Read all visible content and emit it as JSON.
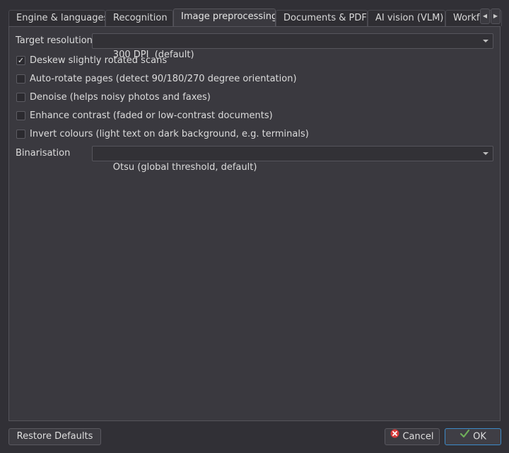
{
  "tabs": [
    {
      "label": "Engine & languages",
      "active": false
    },
    {
      "label": "Recognition",
      "active": false
    },
    {
      "label": "Image preprocessing",
      "active": true
    },
    {
      "label": "Documents & PDF",
      "active": false
    },
    {
      "label": "AI vision (VLM)",
      "active": false
    },
    {
      "label": "Workf",
      "active": false
    }
  ],
  "settings": {
    "target_resolution": {
      "label": "Target resolution",
      "value": "300 DPI  (default)"
    },
    "checkboxes": [
      {
        "label": "Deskew slightly rotated scans",
        "checked": true
      },
      {
        "label": "Auto-rotate pages (detect 90/180/270 degree orientation)",
        "checked": false
      },
      {
        "label": "Denoise (helps noisy photos and faxes)",
        "checked": false
      },
      {
        "label": "Enhance contrast (faded or low-contrast documents)",
        "checked": false
      },
      {
        "label": "Invert colours (light text on dark background, e.g. terminals)",
        "checked": false
      }
    ],
    "binarisation": {
      "label": "Binarisation",
      "value": "Otsu (global threshold, default)"
    }
  },
  "buttons": {
    "restore_defaults": "Restore Defaults",
    "cancel": "Cancel",
    "ok": "OK"
  },
  "colors": {
    "background": "#313036",
    "panel": "#3a393f",
    "accent": "#3d8bc9",
    "cancel_icon": "#d63b3b",
    "ok_icon": "#6fae5a"
  },
  "icons": {
    "cancel": "cancel-x-icon",
    "ok": "ok-check-icon",
    "scroll_left": "chevron-left-icon",
    "scroll_right": "chevron-right-icon",
    "dropdown": "chevron-down-icon"
  }
}
